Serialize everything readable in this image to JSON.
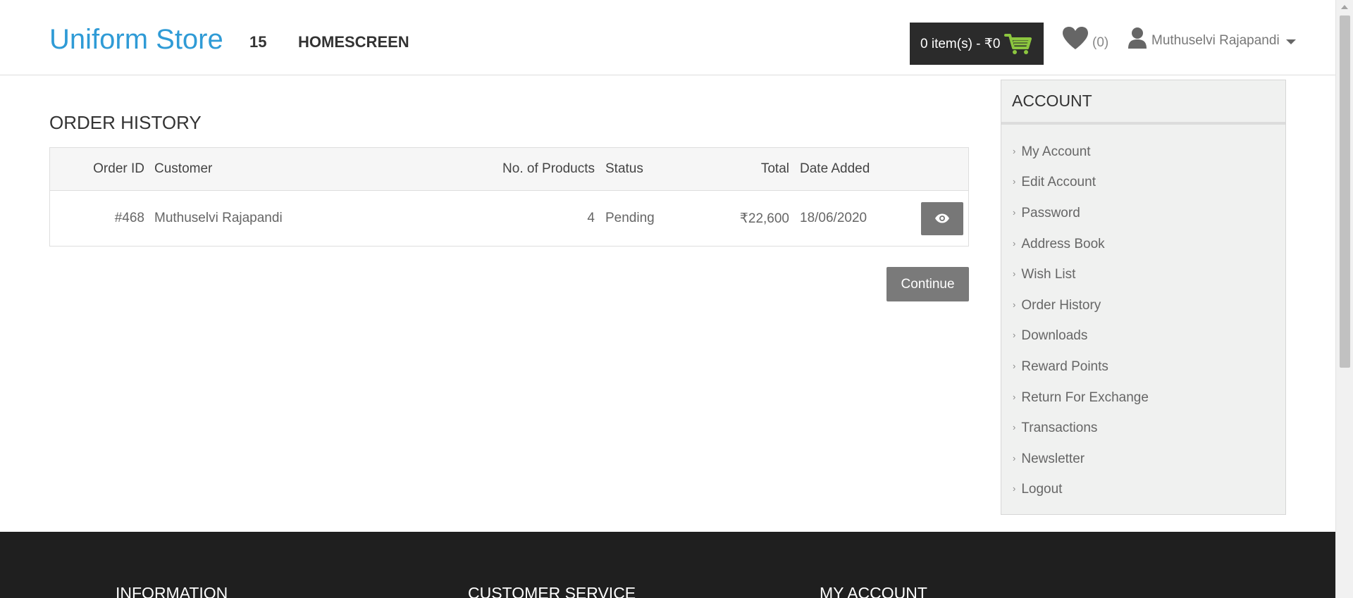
{
  "header": {
    "logo": "Uniform Store",
    "nav_count": "15",
    "nav_home": "HOMESCREEN",
    "cart_label": "0 item(s) - ₹0",
    "wishlist_count": "(0)",
    "user_name": "Muthuselvi Rajapandi"
  },
  "main": {
    "title": "ORDER HISTORY",
    "columns": [
      "Order ID",
      "Customer",
      "No. of Products",
      "Status",
      "Total",
      "Date Added"
    ],
    "orders": [
      {
        "id": "#468",
        "customer": "Muthuselvi Rajapandi",
        "products": "4",
        "status": "Pending",
        "total": "₹22,600",
        "date": "18/06/2020"
      }
    ],
    "continue_label": "Continue"
  },
  "sidebar": {
    "title": "ACCOUNT",
    "items": [
      "My Account",
      "Edit Account",
      "Password",
      "Address Book",
      "Wish List",
      "Order History",
      "Downloads",
      "Reward Points",
      "Return For Exchange",
      "Transactions",
      "Newsletter",
      "Logout"
    ]
  },
  "footer": {
    "col1": "INFORMATION",
    "col2": "CUSTOMER SERVICE",
    "col3": "MY ACCOUNT"
  },
  "colors": {
    "brand": "#2f9bd6",
    "cart_icon": "#8cc63f",
    "cart_bg": "#2b2b2b",
    "footer_bg": "#1f1f1f"
  }
}
